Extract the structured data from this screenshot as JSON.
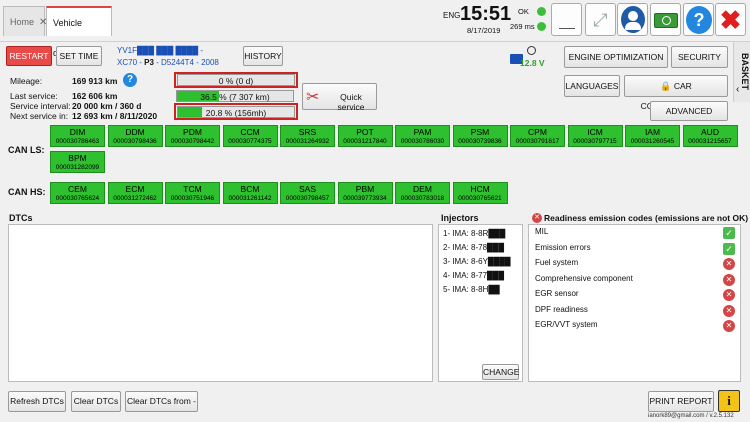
{
  "tabs": [
    {
      "label": "Home"
    },
    {
      "label": "Vehicle detect"
    }
  ],
  "status": {
    "lang": "ENG",
    "time": "15:51",
    "date": "8/17/2019",
    "ok_label": "OK",
    "ping": "269 ms",
    "voltage": "12.8 V"
  },
  "toolbar": {
    "restart": "RESTART",
    "set_time": "SET TIME",
    "history": "HISTORY",
    "vin": "YV1F███ ███ ████ -",
    "model": "XC70",
    "platform": "P3",
    "engine": "D5244T4",
    "year": "2008",
    "engine_optimization": "ENGINE OPTIMIZATION",
    "security": "SECURITY",
    "languages": "LANGUAGES",
    "car_configuration": "CAR CONFIGURATION",
    "advanced": "ADVANCED",
    "basket": "BASKET"
  },
  "service": {
    "mileage_label": "Mileage:",
    "mileage": "169 913 km",
    "last_label": "Last service:",
    "last": "162 606 km",
    "interval_label": "Service interval:",
    "interval": "20 000 km / 360 d",
    "next_label": "Next service in:",
    "next": "12 693 km / 8/11/2020",
    "bar1_text": "0 % (0 d)",
    "bar1_fraction": 0.0,
    "bar2_text": "36.5 % (7 307 km)",
    "bar2_fraction": 0.365,
    "bar3_text": "20.8 % (156mh)",
    "bar3_fraction": 0.208,
    "quick_service": "Quick service"
  },
  "can_ls": {
    "label": "CAN LS:",
    "modules": [
      {
        "name": "DIM",
        "id": "000030786463"
      },
      {
        "name": "DDM",
        "id": "000030798436"
      },
      {
        "name": "PDM",
        "id": "000030798442"
      },
      {
        "name": "CCM",
        "id": "000030774375"
      },
      {
        "name": "SRS",
        "id": "000031264932"
      },
      {
        "name": "POT",
        "id": "000031217840"
      },
      {
        "name": "PAM",
        "id": "000030786030"
      },
      {
        "name": "PSM",
        "id": "000030739836"
      },
      {
        "name": "CPM",
        "id": "000030791617"
      },
      {
        "name": "ICM",
        "id": "000030797715"
      },
      {
        "name": "IAM",
        "id": "000031260545"
      },
      {
        "name": "AUD",
        "id": "000031215657"
      },
      {
        "name": "BPM",
        "id": "000031282099"
      }
    ]
  },
  "can_hs": {
    "label": "CAN HS:",
    "modules": [
      {
        "name": "CEM",
        "id": "000030765624"
      },
      {
        "name": "ECM",
        "id": "000031272462"
      },
      {
        "name": "TCM",
        "id": "000030751946"
      },
      {
        "name": "BCM",
        "id": "000031261142"
      },
      {
        "name": "SAS",
        "id": "000030798457"
      },
      {
        "name": "PBM",
        "id": "000039773934"
      },
      {
        "name": "DEM",
        "id": "000030783018"
      },
      {
        "name": "HCM",
        "id": "000030765621"
      }
    ]
  },
  "dtcs": {
    "title": "DTCs"
  },
  "injectors": {
    "title": "Injectors",
    "items": [
      "1- IMA: 8-8R███",
      "2- IMA: 8-78███",
      "3- IMA: 8-6Y████",
      "4- IMA: 8-77███",
      "5- IMA: 8-8H██"
    ],
    "change": "CHANGE"
  },
  "readiness": {
    "title": "Readiness emission codes (emissions are not OK)",
    "items": [
      {
        "label": "MIL",
        "ok": true
      },
      {
        "label": "Emission errors",
        "ok": true
      },
      {
        "label": "Fuel system",
        "ok": false
      },
      {
        "label": "Comprehensive component",
        "ok": false
      },
      {
        "label": "EGR sensor",
        "ok": false
      },
      {
        "label": "DPF readiness",
        "ok": false
      },
      {
        "label": "EGR/VVT system",
        "ok": false
      }
    ]
  },
  "bottom": {
    "refresh": "Refresh DTCs",
    "clear": "Clear DTCs",
    "clear_from": "Clear DTCs from -",
    "print": "PRINT REPORT",
    "footer": "ianork89@gmail.com / v.2.5.132"
  },
  "colors": {
    "module_green": "#2fc02f",
    "restart_red": "#e84a4a",
    "accent_blue": "#1565c0"
  }
}
